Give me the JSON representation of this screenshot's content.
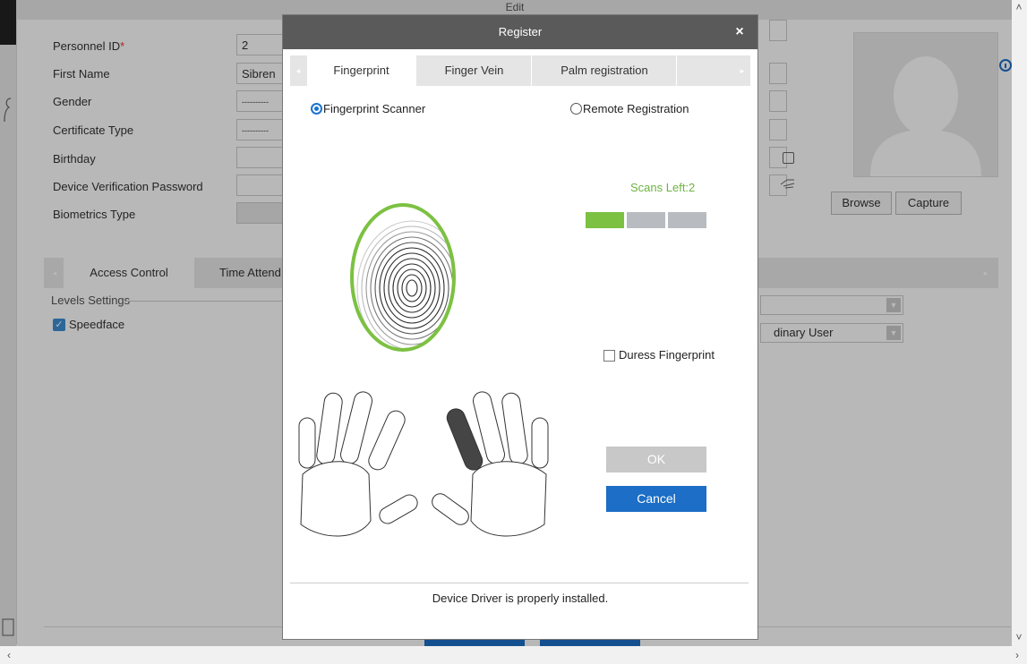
{
  "edit_window": {
    "title": "Edit",
    "fields": [
      {
        "label": "Personnel ID",
        "value": "2",
        "required_mark": "*"
      },
      {
        "label": "First Name",
        "value": "Sibren"
      },
      {
        "label": "Gender",
        "value": "----------"
      },
      {
        "label": "Certificate Type",
        "value": "----------"
      },
      {
        "label": "Birthday",
        "value": ""
      },
      {
        "label": "Device Verification Password",
        "value": ""
      },
      {
        "label": "Biometrics Type",
        "value": ""
      }
    ],
    "browse_label": "Browse",
    "capture_label": "Capture",
    "tabs": [
      "Access Control",
      "Time Attend"
    ],
    "levels_settings_label": "Levels Settings",
    "level_item": "Speedface",
    "level_checked": true,
    "device_role_value": "dinary User"
  },
  "modal": {
    "title": "Register",
    "close_glyph": "×",
    "tabs": [
      {
        "label": "Fingerprint",
        "active": true
      },
      {
        "label": "Finger Vein",
        "active": false
      },
      {
        "label": "Palm registration",
        "active": false
      }
    ],
    "mode_options": [
      {
        "label": "Fingerprint Scanner",
        "selected": true
      },
      {
        "label": "Remote Registration",
        "selected": false
      }
    ],
    "scans_left_text": "Scans Left:2",
    "scan_progress": {
      "completed": 1,
      "total": 3
    },
    "progress_colors": {
      "done": "#7cc142",
      "pending": "#b8bcc0"
    },
    "duress_label": "Duress Fingerprint",
    "duress_checked": false,
    "ok_label": "OK",
    "cancel_label": "Cancel",
    "status_message": "Device Driver is properly installed.",
    "selected_finger": "right-index",
    "accent_color": "#1c6ec6",
    "ring_color": "#7cc142"
  }
}
